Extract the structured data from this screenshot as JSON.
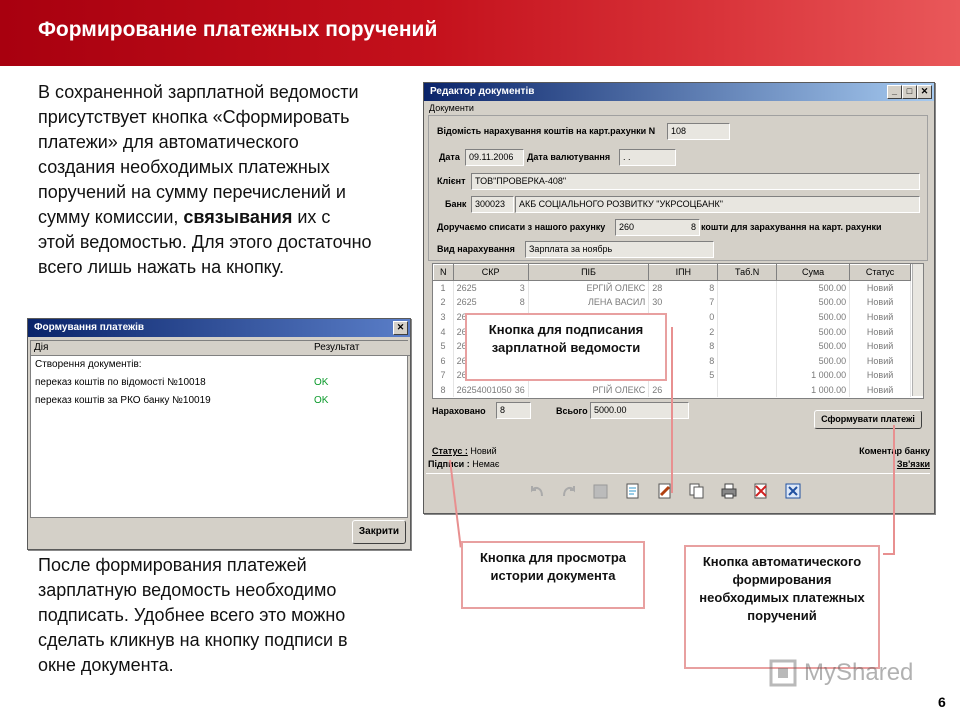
{
  "header": {
    "title": "Формирование платежных поручений"
  },
  "intro_text": {
    "lines": [
      "В сохраненной зарплатной ведомости",
      "присутствует кнопка «Сформировать",
      "платежи» для автоматического",
      "создания необходимых платежных",
      "поручений на сумму перечислений и",
      "сумму комиссии, ",
      "этой ведомостью. Для этого достаточно",
      "всего лишь нажать на кнопку."
    ],
    "bold_word": "связывания",
    "after_bold": " их с"
  },
  "after_text": {
    "lines": [
      "После формирования платежей",
      "зарплатную ведомость необходимо",
      "подписать. Удобнее всего это можно",
      "сделать кликнув на кнопку подписи в",
      "окне документа."
    ]
  },
  "editor": {
    "title": "Редактор документів",
    "menu": "Документи",
    "vidomist_label": "Відомість нарахування коштів на карт.рахунки N",
    "vidomist_value": "108",
    "date_label": "Дата",
    "date_value": "09.11.2006",
    "valut_label": "Дата валютування",
    "valut_value": " .  .",
    "client_label": "Клієнт",
    "client_value": "ТОВ\"ПРОВЕРКА-408\"",
    "bank_label": "Банк",
    "bank_code": "300023",
    "bank_name": "АКБ СОЦІАЛЬНОГО РОЗВИТКУ \"УКРСОЦБАНК\"",
    "spysaty_label": "Доручаємо списати з нашого рахунку",
    "spysaty_value": "260",
    "spysaty_tail": "8",
    "zarah_label": "кошти для зарахування на карт. рахунки",
    "vid_label": "Вид нарахування",
    "vid_value": "Зарплата за ноябрь",
    "columns": [
      "N",
      "СКР",
      "ПІБ",
      "ІПН",
      "Таб.N",
      "Сума",
      "Статус"
    ],
    "rows": [
      {
        "n": "1",
        "skr": "2625",
        "d": "3",
        "pib": "ЕРГІЙ ОЛЕКС",
        "ipn1": "28",
        "ipn2": "8",
        "tab": "",
        "sum": "500.00",
        "status": "Новий"
      },
      {
        "n": "2",
        "skr": "2625",
        "d": "8",
        "pib": "ЛЕНА ВАСИЛ",
        "ipn1": "30",
        "ipn2": "7",
        "tab": "",
        "sum": "500.00",
        "status": "Новий"
      },
      {
        "n": "3",
        "skr": "2625",
        "d": "3",
        "pib": "КАТЕРИНА О",
        "ipn1": "33",
        "ipn2": "0",
        "tab": "",
        "sum": "500.00",
        "status": "Новий"
      },
      {
        "n": "4",
        "skr": "26",
        "d": "",
        "pib": "",
        "ipn1": "",
        "ipn2": "2",
        "tab": "",
        "sum": "500.00",
        "status": "Новий"
      },
      {
        "n": "5",
        "skr": "26",
        "d": "",
        "pib": "",
        "ipn1": "",
        "ipn2": "8",
        "tab": "",
        "sum": "500.00",
        "status": "Новий"
      },
      {
        "n": "6",
        "skr": "26",
        "d": "",
        "pib": "",
        "ipn1": "",
        "ipn2": "8",
        "tab": "",
        "sum": "500.00",
        "status": "Новий"
      },
      {
        "n": "7",
        "skr": "26",
        "d": "",
        "pib": "",
        "ipn1": "",
        "ipn2": "5",
        "tab": "",
        "sum": "1 000.00",
        "status": "Новий"
      },
      {
        "n": "8",
        "skr": "26254001050",
        "d": "36",
        "pib": "РГІЙ ОЛЕКС",
        "ipn1": "26",
        "ipn2": "",
        "tab": "",
        "sum": "1 000.00",
        "status": "Новий"
      }
    ],
    "naraxovano_label": "Нараховано",
    "naraxovano_value": "8",
    "vsogo_label": "Всього",
    "vsogo_value": "5000.00",
    "form_btn": "Сформувати платежі",
    "status_label": "Статус :",
    "status_value": "Новий",
    "pidpys_label": "Підписи :",
    "pidpys_value": "Немає",
    "komentar": "Коментар банку",
    "zvyazky": "Зв'язки"
  },
  "dialog": {
    "title": "Формування платежів",
    "col_dia": "Дія",
    "col_result": "Результат",
    "rows": [
      {
        "text": "Створення документів:",
        "result": ""
      },
      {
        "text": "переказ коштів по відомості №10018",
        "result": "OK"
      },
      {
        "text": "переказ коштів за РКО банку №10019",
        "result": "OK"
      }
    ],
    "close_btn": "Закрити"
  },
  "callouts": {
    "sign": "Кнопка для подписания зарплатной ведомости",
    "history": "Кнопка для просмотра истории документа",
    "auto": "Кнопка автоматического формирования необходимых платежных поручений"
  },
  "watermark": "MyShared",
  "page_number": "6",
  "colors": {
    "accent": "#c4111c",
    "ok": "#0a9a2a",
    "callout_border": "#e8a0a0"
  }
}
